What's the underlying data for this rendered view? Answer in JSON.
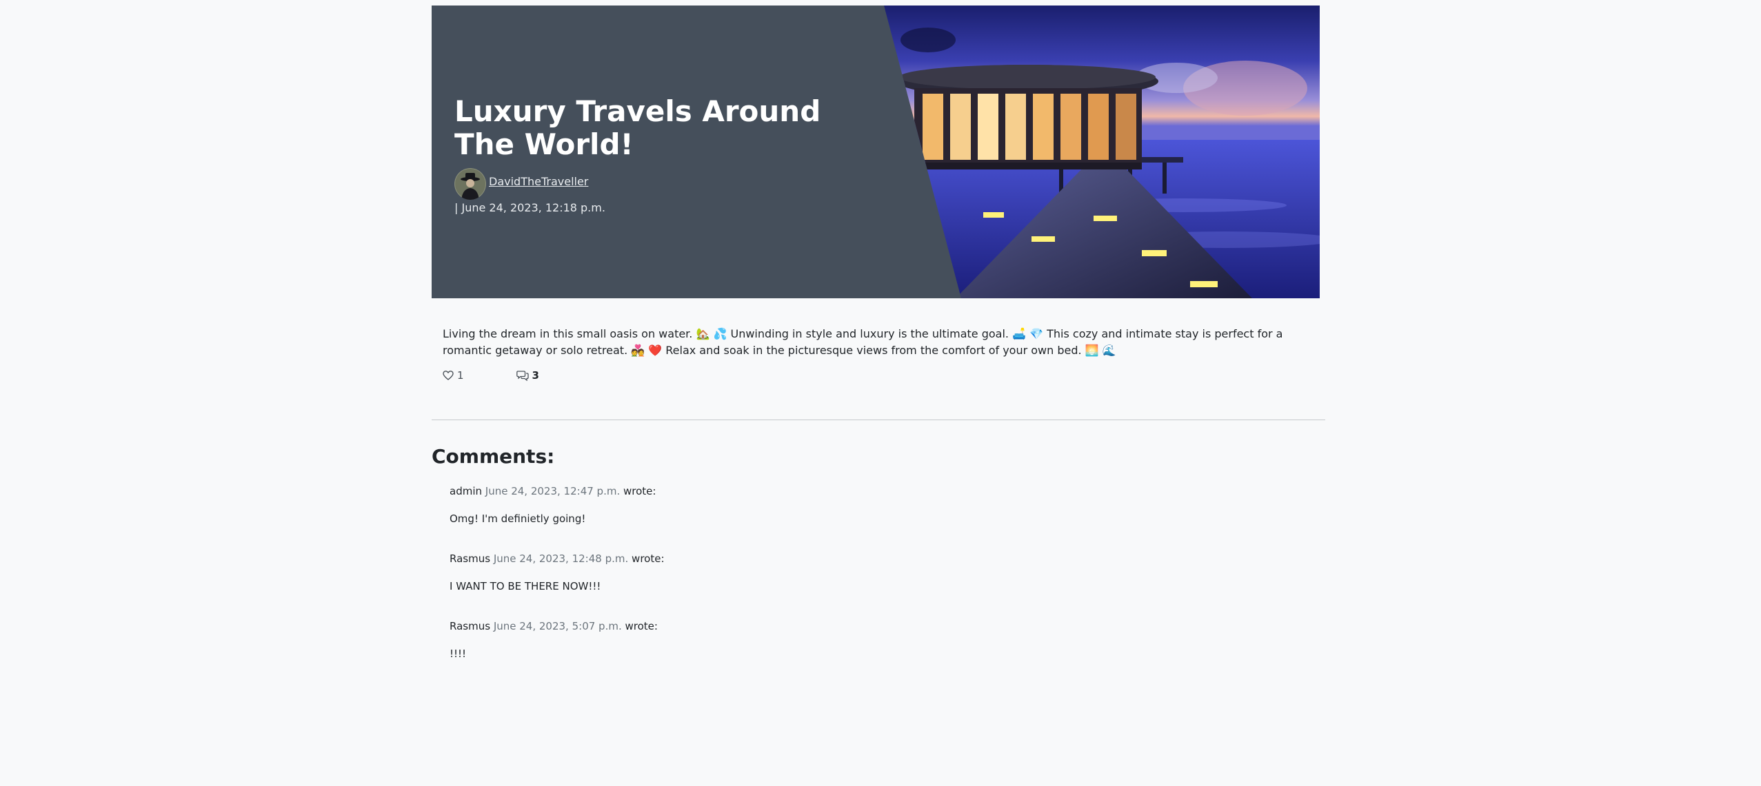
{
  "post": {
    "title": "Luxury Travels Around The World!",
    "author": "DavidTheTraveller",
    "date": "| June 24, 2023, 12:18 p.m.",
    "body": "Living the dream in this small oasis on water. 🏡 💦 Unwinding in style and luxury is the ultimate goal. 🛋️ 💎 This cozy and intimate stay is perfect for a romantic getaway or solo retreat. 💑 ❤️ Relax and soak in the picturesque views from the comfort of your own bed. 🌅 🌊",
    "likes": "1",
    "comment_count": "3"
  },
  "comments_section": {
    "heading": "Comments:",
    "wrote_label": "wrote:",
    "items": [
      {
        "author": "admin",
        "date": "June 24, 2023, 12:47 p.m.",
        "text": "Omg! I'm definietly going!"
      },
      {
        "author": "Rasmus",
        "date": "June 24, 2023, 12:48 p.m.",
        "text": "I WANT TO BE THERE NOW!!!"
      },
      {
        "author": "Rasmus",
        "date": "June 24, 2023, 5:07 p.m.",
        "text": "!!!!"
      }
    ]
  },
  "icons": {
    "like": "heart-icon",
    "comments": "chat-bubbles-icon"
  },
  "colors": {
    "hero_panel": "#454f5b",
    "page_background": "#f8f9fa",
    "muted_text": "#6c757d"
  }
}
